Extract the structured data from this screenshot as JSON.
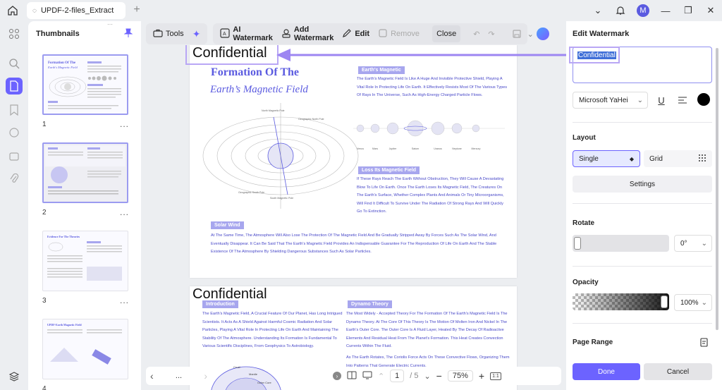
{
  "titlebar": {
    "tab_title": "UPDF-2-files_Extract",
    "avatar_letter": "M"
  },
  "thumbnails": {
    "title": "Thumbnails",
    "pages": [
      "1",
      "2",
      "3",
      "4"
    ],
    "more": "..."
  },
  "toolbar": {
    "tools": "Tools",
    "ai_watermark": "AI Watermark",
    "add_watermark": "Add Watermark",
    "edit": "Edit",
    "remove": "Remove",
    "close": "Close"
  },
  "document": {
    "watermark": "Confidential",
    "page1": {
      "title1": "Formation Of The",
      "title2": "Earth’s Magnetic Field",
      "chip_earths_magnetic": "Earth's Magnetic",
      "para_earths_magnetic": "The Earth's Magnetic Field Is Like A Huge And Invisible Protective Shield, Playing A Vital Role In Protecting Life On Earth. It Effectively Resists Most Of The Various Types Of Rays In The Universe, Such As High-Energy Charged Particle Flows.",
      "chip_loss": "Loss Its Magnetic Field",
      "para_loss": "If These Rays Reach The Earth Without Obstruction, They Will Cause A Devastating Blow To Life On Earth. Once The Earth Loses Its Magnetic Field, The Creatures On The Earth's Surface, Whether Complex Plants And Animals Or Tiny Microorganisms, Will Find It Difficult To Survive Under The Radiation Of Strong Rays And Will Quickly Go To Extinction.",
      "chip_solar": "Solar Wind",
      "para_solar": "At The Same Time, The Atmosphere Will Also Lose The Protection Of The Magnetic Field And Be Gradually Stripped Away By Forces Such As The Solar Wind, And Eventually Disappear. It Can Be Said That The Earth's Magnetic Field Provides An Indispensable Guarantee For The Reproduction Of Life On Earth And The Stable Existence Of The Atmosphere By Shielding Dangerous Substances Such As Solar Particles.",
      "planets": [
        "Venus",
        "Mars",
        "Jupiter",
        "Saturn",
        "Uranus",
        "Neptune",
        "Mercury"
      ],
      "pole_labels": [
        "Geographic North Pole",
        "North Magnetic Pole",
        "Geographic South Pole",
        "South Magnetic Pole"
      ]
    },
    "page2": {
      "chip_intro": "Introduction",
      "para_intro": "The Earth's Magnetic Field, A Crucial Feature Of Our Planet, Has Long Intrigued Scientists. It Acts As A Shield Against Harmful Cosmic Radiation And Solar Particles, Playing A Vital Role In Protecting Life On Earth And Maintaining The Stability Of The Atmosphere. Understanding Its Formation Is Fundamental To Various Scientific Disciplines, From Geophysics To Astrobiology.",
      "chip_dynamo": "Dynamo Theory",
      "para_dynamo": "The Most Widely - Accepted Theory For The Formation Of The Earth's Magnetic Field Is The Dynamo Theory. At The Core Of This Theory Is The Motion Of Molten Iron And Nickel In The Earth's Outer Core. The Outer Core Is A Fluid Layer, Heated By The Decay Of Radioactive Elements And Residual Heat From The Planet's Formation. This Heat Creates Convection Currents Within The Fluid.",
      "para_dynamo2": "As The Earth Rotates, The Coriolis Force Acts On These Convective Flows, Organizing Them Into Patterns That Generate Electric Currents.",
      "labels": [
        "Crust",
        "Mantle",
        "Outer Core"
      ]
    }
  },
  "navbar": {
    "current_page": "1",
    "total_pages": "/ 5",
    "zoom": "75%",
    "more": "..."
  },
  "panel": {
    "title": "Edit Watermark",
    "text_value": "Confidential",
    "font": "Microsoft YaHei",
    "color": "#000000",
    "layout_label": "Layout",
    "single": "Single",
    "grid": "Grid",
    "settings": "Settings",
    "rotate_label": "Rotate",
    "rotate_value": "0°",
    "rotate_level": 0,
    "opacity_label": "Opacity",
    "opacity_value": "100%",
    "opacity_level": 1.0,
    "page_range_label": "Page Range",
    "done": "Done",
    "cancel": "Cancel"
  },
  "colors": {
    "accent": "#6c63ff",
    "doc_blue": "#5b5be0",
    "highlight": "#b9a7f5",
    "arrow": "#9d86f2"
  }
}
